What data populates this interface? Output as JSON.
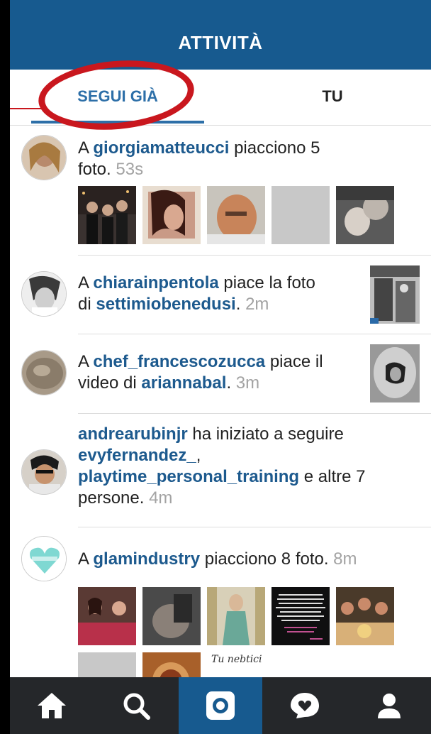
{
  "header": {
    "title": "ATTIVITÀ"
  },
  "tabs": [
    {
      "label": "SEGUI GIÀ"
    },
    {
      "label": "TU"
    }
  ],
  "feed": [
    {
      "prefix": "A ",
      "user": "giorgiamatteucci",
      "action": " piacciono 5",
      "action2": "foto.",
      "time": " 53s"
    },
    {
      "prefix": "A ",
      "user": "chiarainpentola",
      "action": " piace la foto",
      "action2pre": "di ",
      "user2": "settimiobenedusi",
      "action2": ".",
      "time": " 2m"
    },
    {
      "prefix": "A ",
      "user": "chef_francescozucca",
      "action": " piace il",
      "action2pre": "video di ",
      "user2": "ariannabal",
      "action2": ".",
      "time": " 3m"
    },
    {
      "user": "andrearubinjr",
      "action": " ha iniziato a seguire",
      "user2": "evyfernandez_",
      "sep": ",",
      "user3": "playtime_personal_training",
      "action3": " e altre 7",
      "action4": "persone.",
      "time": " 4m"
    },
    {
      "prefix": "A ",
      "user": "glamindustry",
      "action": " piacciono 8 foto.",
      "time": " 8m"
    }
  ],
  "thumb_text": {
    "tu_nebtici": "Tu nebtici"
  },
  "colors": {
    "header": "#175a8f",
    "link": "#1d5a8e",
    "tab_active": "#2d6fa8",
    "annotation": "#c9171e",
    "nav_bg": "#25272a"
  },
  "nav": [
    {
      "icon": "home-icon"
    },
    {
      "icon": "search-icon"
    },
    {
      "icon": "camera-icon"
    },
    {
      "icon": "activity-heart-icon"
    },
    {
      "icon": "profile-icon"
    }
  ]
}
